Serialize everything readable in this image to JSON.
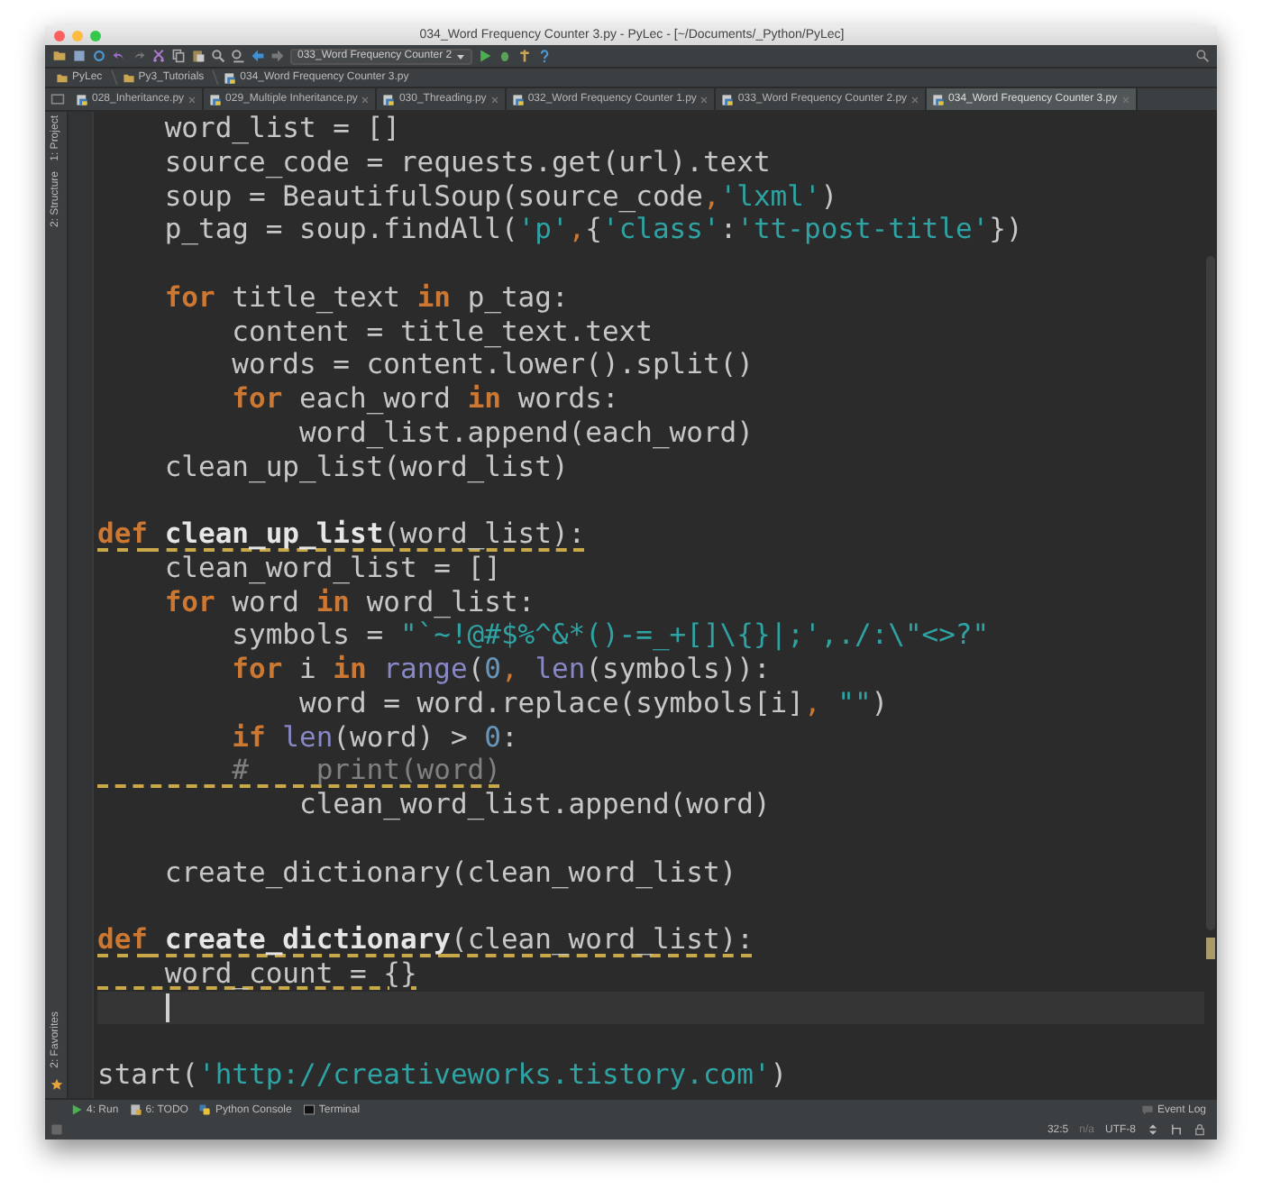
{
  "window": {
    "title": "034_Word Frequency Counter 3.py - PyLec - [~/Documents/_Python/PyLec]"
  },
  "toolbar": {
    "run_config": "033_Word Frequency Counter 2"
  },
  "breadcrumb": [
    "PyLec",
    "Py3_Tutorials",
    "034_Word Frequency Counter 3.py"
  ],
  "tabs": [
    {
      "label": "028_Inheritance.py",
      "selected": false
    },
    {
      "label": "029_Multiple Inheritance.py",
      "selected": false
    },
    {
      "label": "030_Threading.py",
      "selected": false
    },
    {
      "label": "032_Word Frequency Counter 1.py",
      "selected": false
    },
    {
      "label": "033_Word Frequency Counter 2.py",
      "selected": false
    },
    {
      "label": "034_Word Frequency Counter 3.py",
      "selected": true
    }
  ],
  "side_tools": {
    "top": [
      "1: Project",
      "2: Structure"
    ],
    "bottom": [
      "2: Favorites"
    ]
  },
  "code_lines": [
    {
      "kind": "code",
      "warning": false,
      "tokens": [
        {
          "kind": "plain",
          "text": "    word_list = []"
        }
      ]
    },
    {
      "kind": "code",
      "warning": false,
      "tokens": [
        {
          "kind": "plain",
          "text": "    source_code = requests.get(url).text"
        }
      ]
    },
    {
      "kind": "code",
      "warning": false,
      "tokens": [
        {
          "kind": "plain",
          "text": "    soup = BeautifulSoup(source_code"
        },
        {
          "kind": "punct",
          "text": ","
        },
        {
          "kind": "string",
          "text": "'lxml'"
        },
        {
          "kind": "plain",
          "text": ")"
        }
      ]
    },
    {
      "kind": "code",
      "warning": false,
      "tokens": [
        {
          "kind": "plain",
          "text": "    p_tag = soup.findAll("
        },
        {
          "kind": "string",
          "text": "'p'"
        },
        {
          "kind": "punct",
          "text": ","
        },
        {
          "kind": "plain",
          "text": "{"
        },
        {
          "kind": "string",
          "text": "'class'"
        },
        {
          "kind": "plain",
          "text": ":"
        },
        {
          "kind": "string",
          "text": "'tt-post-title'"
        },
        {
          "kind": "plain",
          "text": "})"
        }
      ]
    },
    {
      "kind": "blank"
    },
    {
      "kind": "code",
      "warning": false,
      "tokens": [
        {
          "kind": "keyword",
          "text": "    for"
        },
        {
          "kind": "plain",
          "text": " title_text "
        },
        {
          "kind": "keyword",
          "text": "in"
        },
        {
          "kind": "plain",
          "text": " p_tag:"
        }
      ]
    },
    {
      "kind": "code",
      "warning": false,
      "tokens": [
        {
          "kind": "plain",
          "text": "        content = title_text.text"
        }
      ]
    },
    {
      "kind": "code",
      "warning": false,
      "tokens": [
        {
          "kind": "plain",
          "text": "        words = content.lower().split()"
        }
      ]
    },
    {
      "kind": "code",
      "warning": false,
      "tokens": [
        {
          "kind": "keyword",
          "text": "        for"
        },
        {
          "kind": "plain",
          "text": " each_word "
        },
        {
          "kind": "keyword",
          "text": "in"
        },
        {
          "kind": "plain",
          "text": " words:"
        }
      ]
    },
    {
      "kind": "code",
      "warning": false,
      "tokens": [
        {
          "kind": "plain",
          "text": "            word_list.append(each_word)"
        }
      ]
    },
    {
      "kind": "code",
      "warning": false,
      "tokens": [
        {
          "kind": "plain",
          "text": "    clean_up_list(word_list)"
        }
      ]
    },
    {
      "kind": "blank"
    },
    {
      "kind": "code",
      "warning": true,
      "tokens": [
        {
          "kind": "keyword",
          "text": "def"
        },
        {
          "kind": "function",
          "text": " clean_up_list"
        },
        {
          "kind": "plain",
          "text": "(word_list):"
        }
      ]
    },
    {
      "kind": "code",
      "warning": false,
      "tokens": [
        {
          "kind": "plain",
          "text": "    clean_word_list = []"
        }
      ]
    },
    {
      "kind": "code",
      "warning": false,
      "tokens": [
        {
          "kind": "keyword",
          "text": "    for"
        },
        {
          "kind": "plain",
          "text": " word "
        },
        {
          "kind": "keyword",
          "text": "in"
        },
        {
          "kind": "plain",
          "text": " word_list:"
        }
      ]
    },
    {
      "kind": "code",
      "warning": false,
      "tokens": [
        {
          "kind": "plain",
          "text": "        symbols = "
        },
        {
          "kind": "string",
          "text": "\"`~!@#$%^&*()-=_+[]\\{}|;',./:\\\"<>?\""
        }
      ]
    },
    {
      "kind": "code",
      "warning": false,
      "tokens": [
        {
          "kind": "keyword",
          "text": "        for"
        },
        {
          "kind": "plain",
          "text": " i "
        },
        {
          "kind": "keyword",
          "text": "in"
        },
        {
          "kind": "builtin",
          "text": " range"
        },
        {
          "kind": "plain",
          "text": "("
        },
        {
          "kind": "number",
          "text": "0"
        },
        {
          "kind": "punct",
          "text": ","
        },
        {
          "kind": "builtin",
          "text": " len"
        },
        {
          "kind": "plain",
          "text": "(symbols)):"
        }
      ]
    },
    {
      "kind": "code",
      "warning": false,
      "tokens": [
        {
          "kind": "plain",
          "text": "            word = word.replace(symbols[i]"
        },
        {
          "kind": "punct",
          "text": ","
        },
        {
          "kind": "string",
          "text": " \"\""
        },
        {
          "kind": "plain",
          "text": ")"
        }
      ]
    },
    {
      "kind": "code",
      "warning": false,
      "tokens": [
        {
          "kind": "keyword",
          "text": "        if"
        },
        {
          "kind": "builtin",
          "text": " len"
        },
        {
          "kind": "plain",
          "text": "(word) > "
        },
        {
          "kind": "number",
          "text": "0"
        },
        {
          "kind": "plain",
          "text": ":"
        }
      ]
    },
    {
      "kind": "code",
      "warning": true,
      "tokens": [
        {
          "kind": "comment",
          "text": "        #    print(word)"
        }
      ]
    },
    {
      "kind": "code",
      "warning": false,
      "tokens": [
        {
          "kind": "plain",
          "text": "            clean_word_list.append(word)"
        }
      ]
    },
    {
      "kind": "blank"
    },
    {
      "kind": "code",
      "warning": false,
      "tokens": [
        {
          "kind": "plain",
          "text": "    create_dictionary(clean_word_list)"
        }
      ]
    },
    {
      "kind": "blank"
    },
    {
      "kind": "code",
      "warning": true,
      "tokens": [
        {
          "kind": "keyword",
          "text": "def"
        },
        {
          "kind": "function",
          "text": " create_dictionary"
        },
        {
          "kind": "plain",
          "text": "(clean_word_list):"
        }
      ]
    },
    {
      "kind": "code",
      "warning": true,
      "tokens": [
        {
          "kind": "plain",
          "text": "    word_count = {}"
        }
      ]
    },
    {
      "kind": "caret"
    },
    {
      "kind": "blank"
    },
    {
      "kind": "code",
      "warning": false,
      "tokens": [
        {
          "kind": "plain",
          "text": "start("
        },
        {
          "kind": "string",
          "text": "'http://creativeworks.tistory.com'"
        },
        {
          "kind": "plain",
          "text": ")"
        }
      ]
    }
  ],
  "tool_windows": [
    "4: Run",
    "6: TODO",
    "Python Console",
    "Terminal"
  ],
  "event_log": "Event Log",
  "status_bar": {
    "position": "32:5",
    "line_separator": "n/a",
    "encoding": "UTF-8"
  }
}
